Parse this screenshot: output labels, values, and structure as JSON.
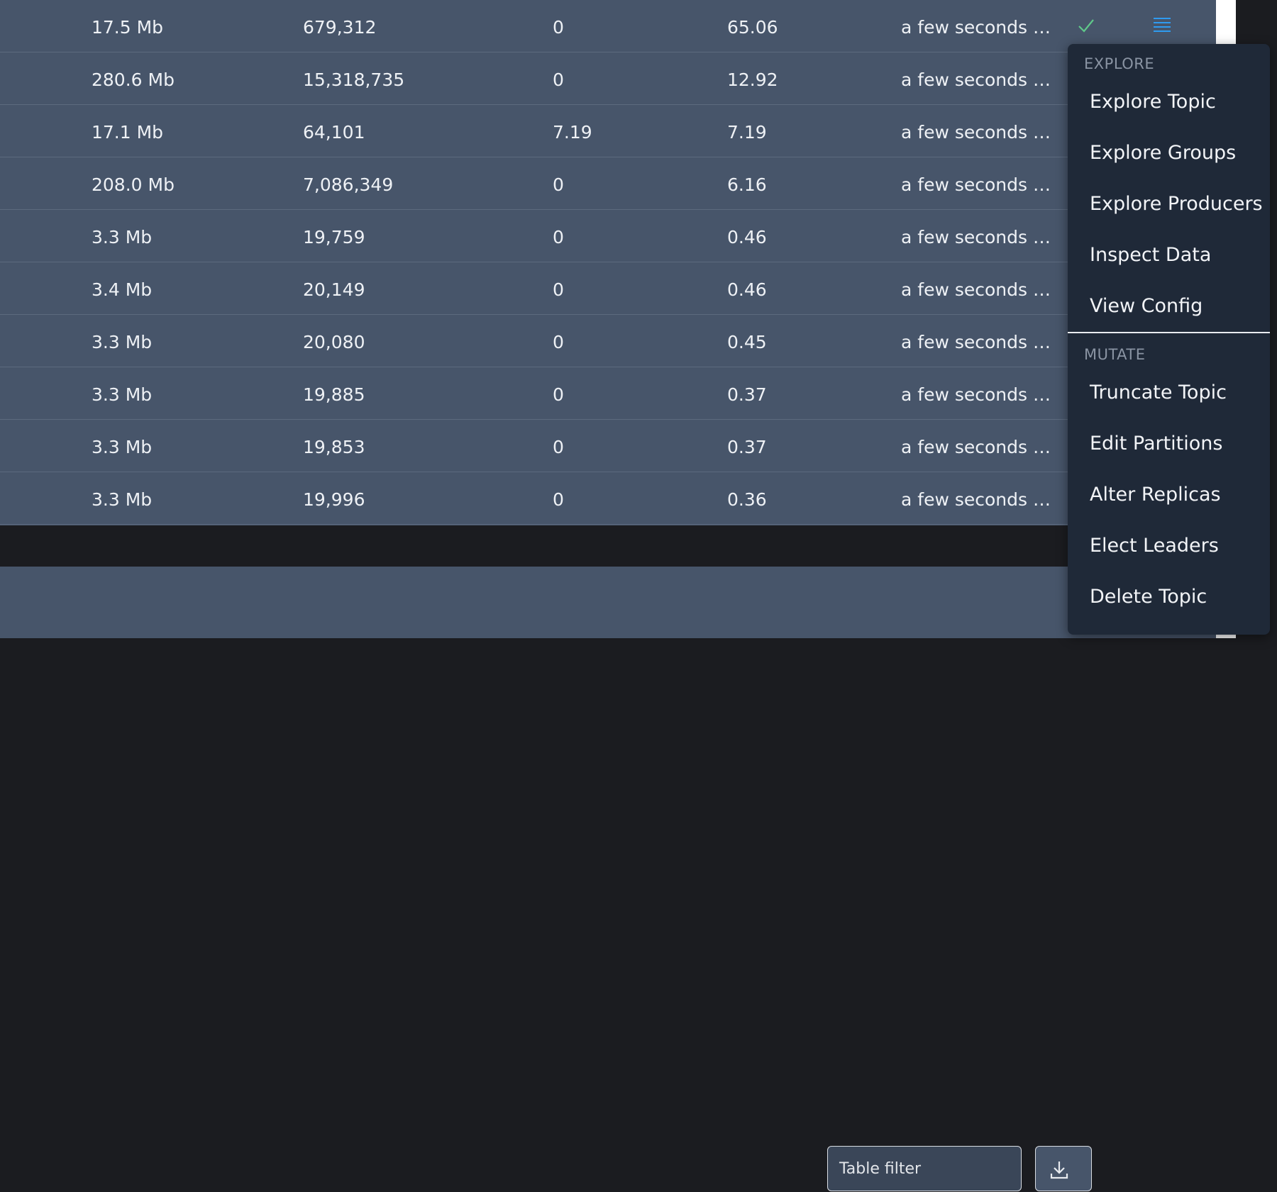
{
  "table": {
    "rows": [
      {
        "size": "17.5 Mb",
        "messages": "679,312",
        "rate_a": "0",
        "rate_b": "65.06",
        "updated": "a few seconds ago",
        "checked": true,
        "has_menu": true
      },
      {
        "size": "280.6 Mb",
        "messages": "15,318,735",
        "rate_a": "0",
        "rate_b": "12.92",
        "updated": "a few seconds ago"
      },
      {
        "size": "17.1 Mb",
        "messages": "64,101",
        "rate_a": "7.19",
        "rate_b": "7.19",
        "updated": "a few seconds ago"
      },
      {
        "size": "208.0 Mb",
        "messages": "7,086,349",
        "rate_a": "0",
        "rate_b": "6.16",
        "updated": "a few seconds ago"
      },
      {
        "size": "3.3 Mb",
        "messages": "19,759",
        "rate_a": "0",
        "rate_b": "0.46",
        "updated": "a few seconds ago"
      },
      {
        "size": "3.4 Mb",
        "messages": "20,149",
        "rate_a": "0",
        "rate_b": "0.46",
        "updated": "a few seconds ago"
      },
      {
        "size": "3.3 Mb",
        "messages": "20,080",
        "rate_a": "0",
        "rate_b": "0.45",
        "updated": "a few seconds ago"
      },
      {
        "size": "3.3 Mb",
        "messages": "19,885",
        "rate_a": "0",
        "rate_b": "0.37",
        "updated": "a few seconds ago"
      },
      {
        "size": "3.3 Mb",
        "messages": "19,853",
        "rate_a": "0",
        "rate_b": "0.37",
        "updated": "a few seconds ago"
      },
      {
        "size": "3.3 Mb",
        "messages": "19,996",
        "rate_a": "0",
        "rate_b": "0.36",
        "updated": "a few seconds ago"
      }
    ]
  },
  "footer": {
    "filter_placeholder": "Table filter",
    "download_icon": "download-icon"
  },
  "menu": {
    "explore_header": "EXPLORE",
    "explore_items": [
      "Explore Topic",
      "Explore Groups",
      "Explore Producers",
      "Inspect Data",
      "View Config"
    ],
    "mutate_header": "MUTATE",
    "mutate_items": [
      "Truncate Topic",
      "Edit Partitions",
      "Alter Replicas",
      "Elect Leaders",
      "Delete Topic"
    ]
  },
  "colors": {
    "table_bg": "#47556a",
    "menu_bg": "#1f2938",
    "check_green": "#5fc88a",
    "menu_icon_blue": "#2f9bf0"
  }
}
